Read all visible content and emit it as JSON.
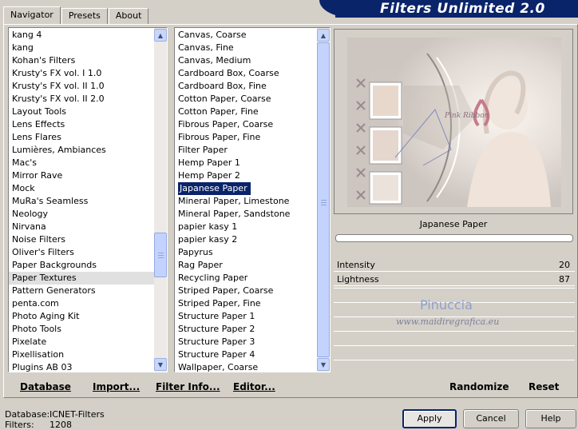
{
  "header": {
    "title": "Filters Unlimited 2.0"
  },
  "tabs": [
    {
      "label": "Navigator",
      "active": true
    },
    {
      "label": "Presets",
      "active": false
    },
    {
      "label": "About",
      "active": false
    }
  ],
  "categories": {
    "items": [
      "kang 4",
      "kang",
      "Kohan's Filters",
      "Krusty's FX vol. I 1.0",
      "Krusty's FX vol. II 1.0",
      "Krusty's FX vol. II 2.0",
      "Layout Tools",
      "Lens Effects",
      "Lens Flares",
      "Lumières, Ambiances",
      "Mac's",
      "Mirror Rave",
      "Mock",
      "MuRa's Seamless",
      "Neology",
      "Nirvana",
      "Noise Filters",
      "Oliver's Filters",
      "Paper Backgrounds",
      "Paper Textures",
      "Pattern Generators",
      "penta.com",
      "Photo Aging Kit",
      "Photo Tools",
      "Pixelate",
      "Pixellisation",
      "Plugins AB 03"
    ],
    "selected": "Paper Textures"
  },
  "filters": {
    "items": [
      "Canvas, Coarse",
      "Canvas, Fine",
      "Canvas, Medium",
      "Cardboard Box, Coarse",
      "Cardboard Box, Fine",
      "Cotton Paper, Coarse",
      "Cotton Paper, Fine",
      "Fibrous Paper, Coarse",
      "Fibrous Paper, Fine",
      "Filter Paper",
      "Hemp Paper 1",
      "Hemp Paper 2",
      "Japanese Paper",
      "Mineral Paper, Limestone",
      "Mineral Paper, Sandstone",
      "papier kasy 1",
      "papier kasy 2",
      "Papyrus",
      "Rag Paper",
      "Recycling Paper",
      "Striped Paper, Coarse",
      "Striped Paper, Fine",
      "Structure Paper 1",
      "Structure Paper 2",
      "Structure Paper 3",
      "Structure Paper 4",
      "Wallpaper, Coarse"
    ],
    "selected": "Japanese Paper"
  },
  "preview": {
    "filter_name": "Japanese Paper",
    "watermark_name": "Pinuccia",
    "watermark_url": "www.maidiregrafica.eu",
    "inner_text": "Pink Ribbon"
  },
  "sliders": [
    {
      "label": "Intensity",
      "value": "20"
    },
    {
      "label": "Lightness",
      "value": "87"
    }
  ],
  "left_buttons": {
    "database": "Database",
    "import": "Import...",
    "filter_info": "Filter Info...",
    "editor": "Editor..."
  },
  "right_buttons": {
    "randomize": "Randomize",
    "reset": "Reset"
  },
  "status": {
    "database_label": "Database:",
    "database_value": "ICNET-Filters",
    "filters_label": "Filters:",
    "filters_value": "1208"
  },
  "dialog_buttons": {
    "apply": "Apply",
    "cancel": "Cancel",
    "help": "Help"
  },
  "colors": {
    "header_bg": "#0a246a",
    "selection": "#0a246a",
    "scroll_thumb": "#c3d3fd"
  }
}
